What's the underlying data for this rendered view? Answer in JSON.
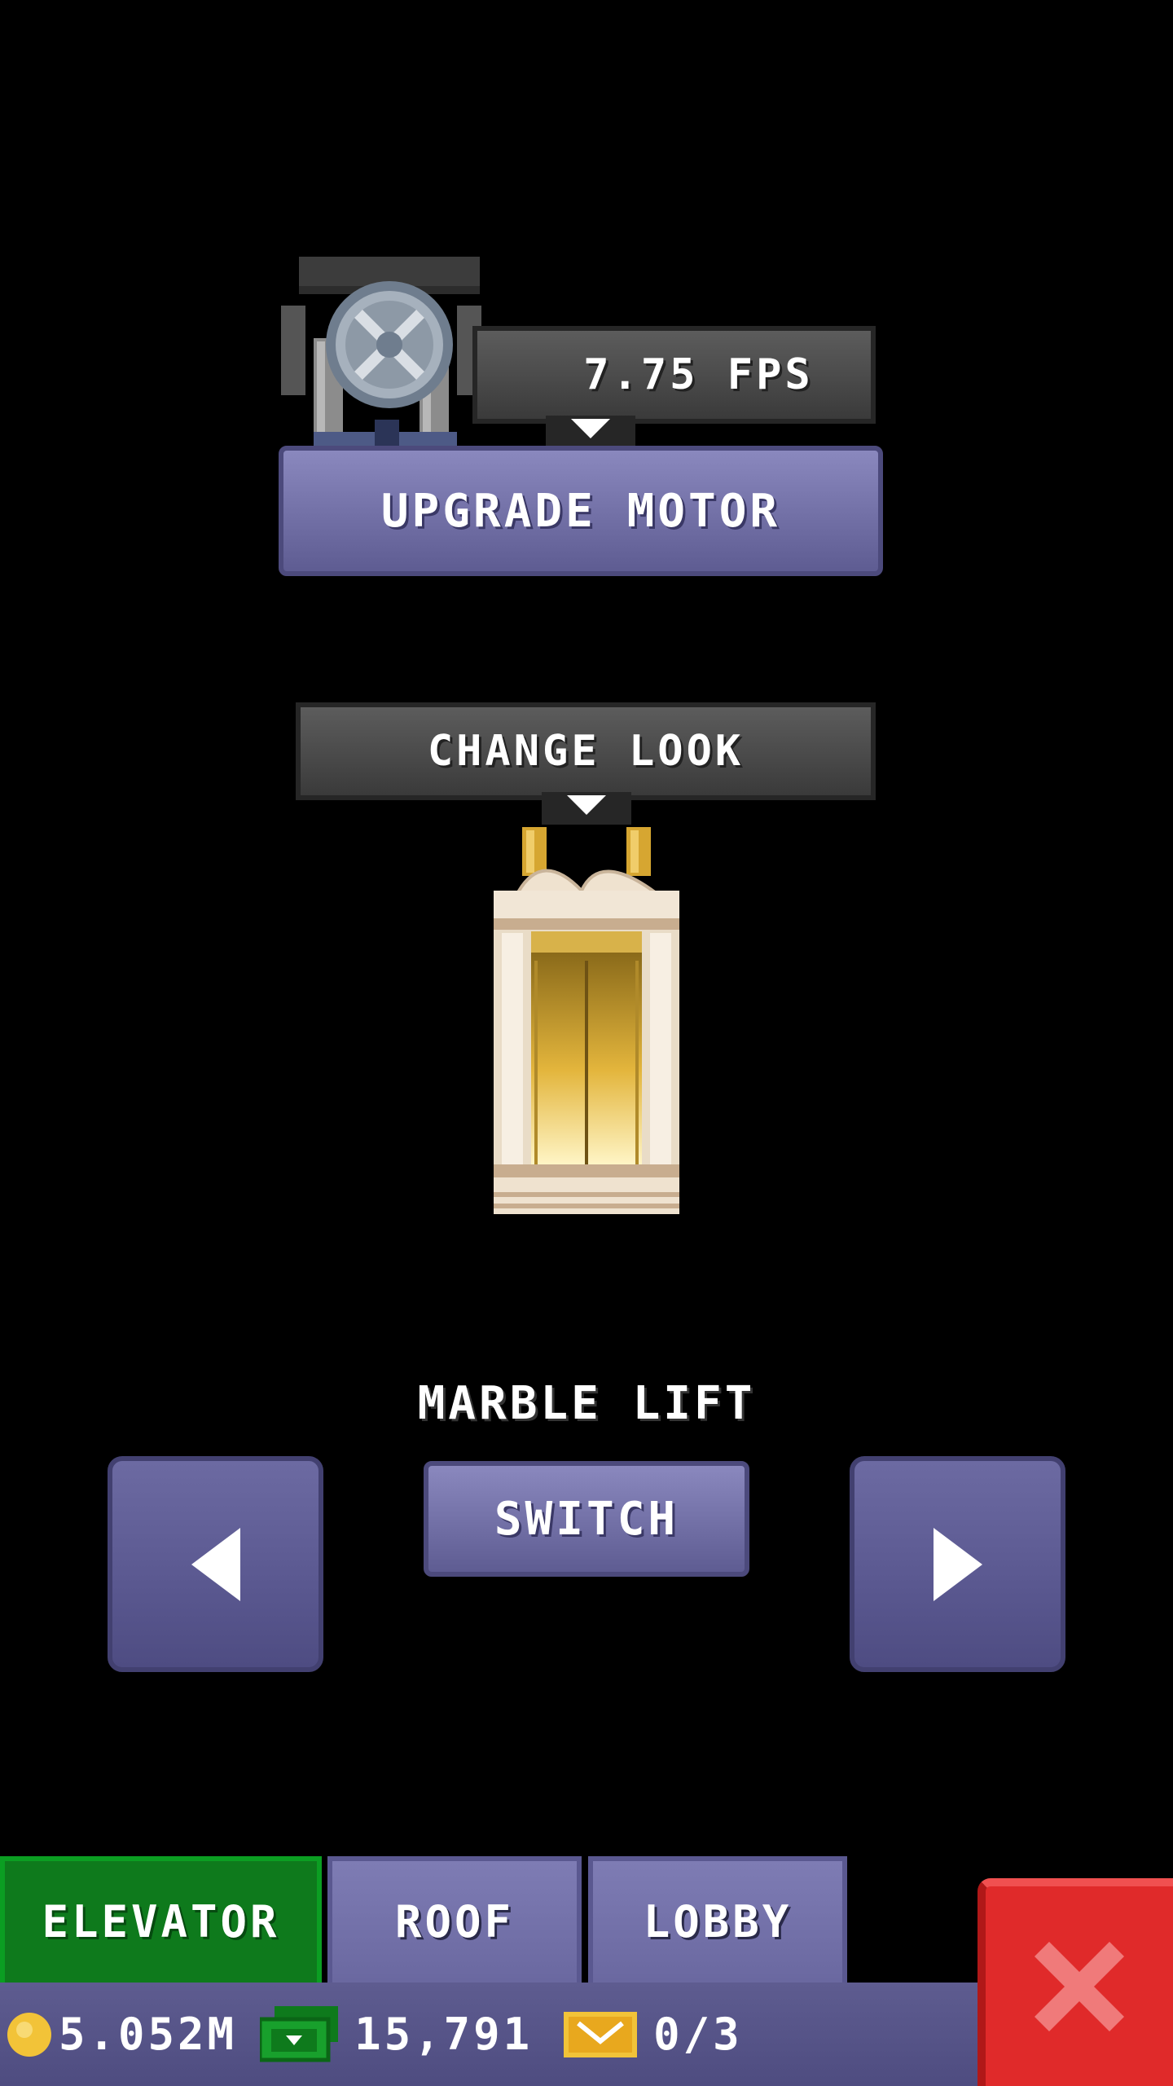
{
  "motor": {
    "speed_label": "7.75 FPS",
    "upgrade_label": "UPGRADE MOTOR",
    "icon": "motor-wheel-icon"
  },
  "look": {
    "change_label": "CHANGE LOOK",
    "current_name": "MARBLE LIFT",
    "switch_label": "SWITCH",
    "preview_icon": "marble-elevator-car"
  },
  "nav": {
    "prev_icon": "arrow-left-icon",
    "next_icon": "arrow-right-icon"
  },
  "tabs": [
    {
      "label": "ELEVATOR",
      "active": true
    },
    {
      "label": "ROOF",
      "active": false
    },
    {
      "label": "LOBBY",
      "active": false
    }
  ],
  "status": {
    "coins": "5.052M",
    "bux": "15,791",
    "tickets": "0/3"
  },
  "close_icon": "close-x-icon",
  "colors": {
    "purple": "#7472a8",
    "active_tab": "#0e7a1c",
    "close_red": "#e02a2a",
    "gold": "#f2c338",
    "cash_green": "#18a02c"
  }
}
